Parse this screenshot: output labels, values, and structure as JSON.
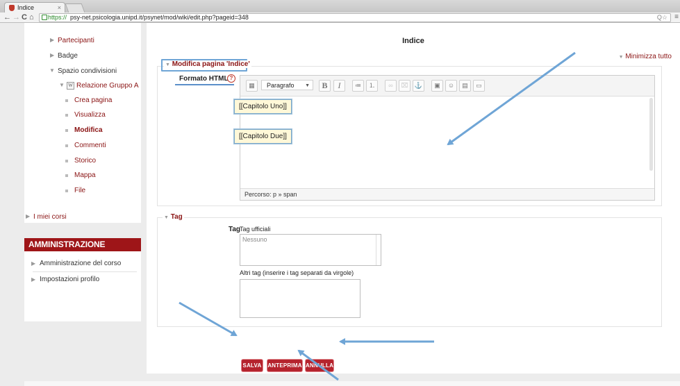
{
  "browser": {
    "tab_title": "Indice",
    "tab_close": "×",
    "url_https": "https://",
    "url_rest": "psy-net.psicologia.unipd.it/psynet/mod/wiki/edit.php?pageid=348",
    "url_icons": "Q☆",
    "nav_back": "←",
    "nav_forward": "→",
    "nav_reload": "C",
    "nav_home": "⌂",
    "menu_icon": "≡"
  },
  "sidebar": {
    "items": [
      {
        "label": "Partecipanti"
      },
      {
        "label": "Badge"
      },
      {
        "label": "Spazio condivisioni"
      },
      {
        "label": "Relazione Gruppo A",
        "icon_letter": "W"
      },
      {
        "label": "Crea pagina"
      },
      {
        "label": "Visualizza"
      },
      {
        "label": "Modifica"
      },
      {
        "label": "Commenti"
      },
      {
        "label": "Storico"
      },
      {
        "label": "Mappa"
      },
      {
        "label": "File"
      },
      {
        "label": "I miei corsi"
      }
    ]
  },
  "admin": {
    "header": "AMMINISTRAZIONE",
    "items": [
      {
        "label": "Amministrazione del corso"
      },
      {
        "label": "Impostazioni profilo"
      }
    ]
  },
  "main": {
    "title": "Indice",
    "collapse_all": "Minimizza tutto",
    "edit_section": {
      "legend": "Modifica pagina 'Indice'",
      "format_label": "Formato HTML",
      "help_icon": "?",
      "toolbar": {
        "paragraph_select": "Paragrafo",
        "bold": "B",
        "italic": "I"
      },
      "content_lines": [
        "[[Capitolo Uno]]",
        "[[Capitolo Due]]"
      ],
      "status_path": "Percorso: p » span"
    },
    "tag_section": {
      "legend": "Tag",
      "tag_label": "Tag",
      "official_label": "Tag ufficiali",
      "official_placeholder": "Nessuno",
      "other_label": "Altri tag (inserire i tag separati da virgole)"
    },
    "buttons": {
      "save": "SALVA",
      "preview": "ANTEPRIMA",
      "cancel": "ANNULLA"
    }
  },
  "colors": {
    "brand_red": "#9e1518",
    "link_red": "#8a1313",
    "annotation_blue": "#6fa5d6"
  }
}
